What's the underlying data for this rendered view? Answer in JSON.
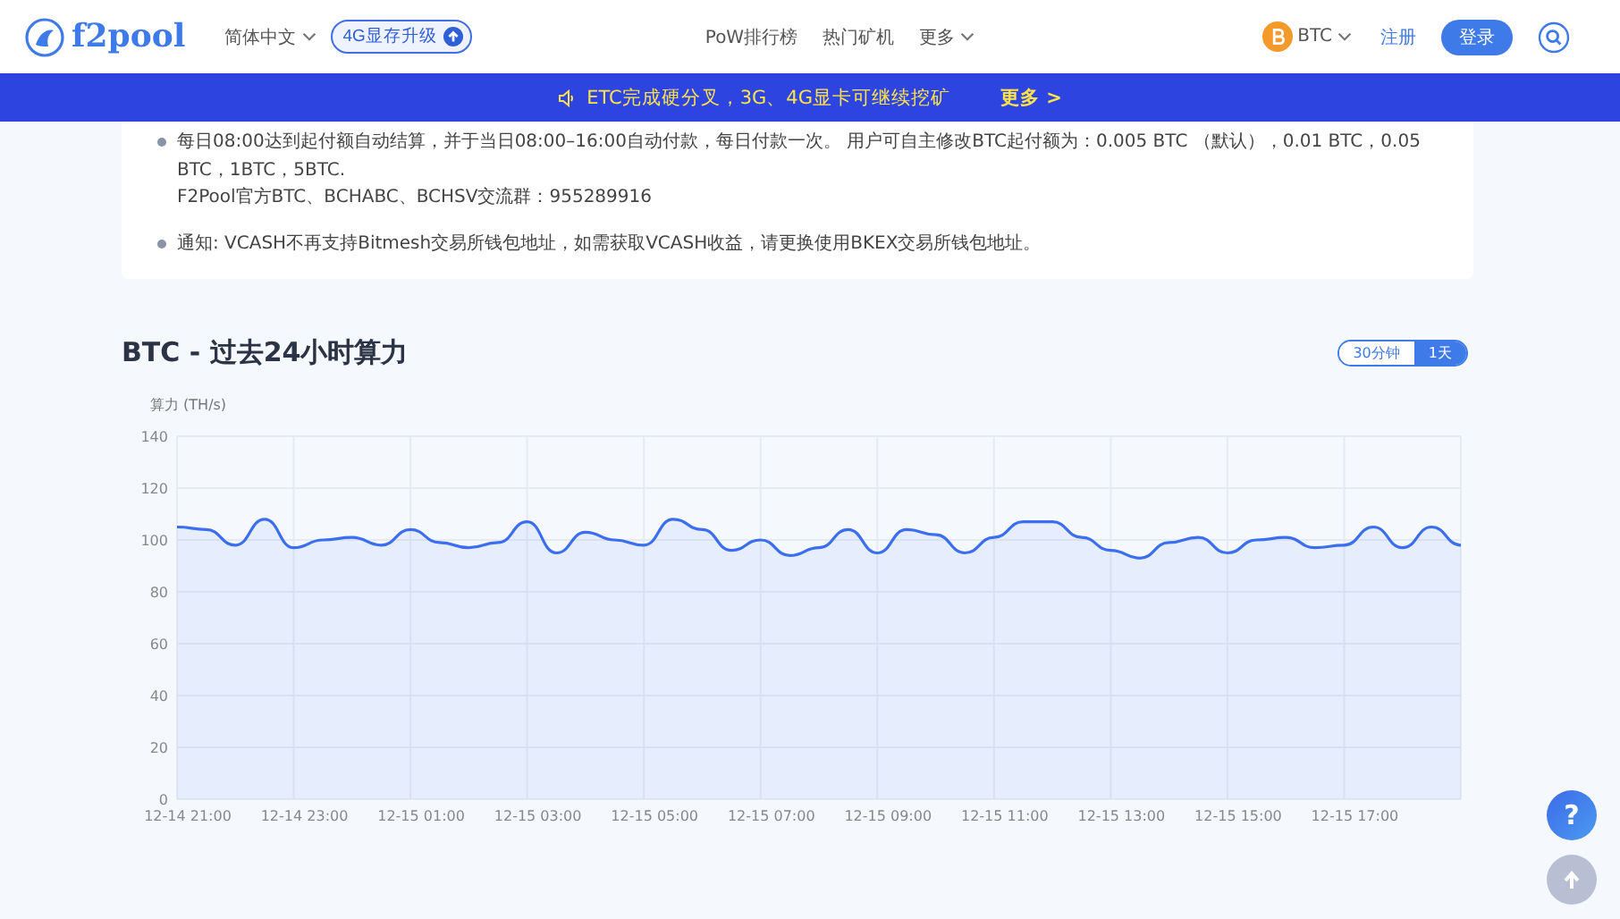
{
  "header": {
    "logo": "f2pool",
    "language": "简体中文",
    "upgrade_badge": "4G显存升级",
    "nav": [
      "PoW排行榜",
      "热门矿机",
      "更多"
    ],
    "coin": "BTC",
    "register": "注册",
    "login": "登录"
  },
  "banner": {
    "text": "ETC完成硬分叉，3G、4G显卡可继续挖矿",
    "link": "更多 >"
  },
  "notices": [
    {
      "text": "每日08:00达到起付额自动结算，并于当日08:00–16:00自动付款，每日付款一次。 用户可自主修改BTC起付额为：0.005 BTC （默认），0.01 BTC，0.05 BTC，1BTC，5BTC.",
      "note": "F2Pool官方BTC、BCHABC、BCHSV交流群：955289916"
    },
    {
      "text": "通知: VCASH不再支持Bitmesh交易所钱包地址，如需获取VCASH收益，请更换使用BKEX交易所钱包地址。"
    }
  ],
  "section_title": "BTC - 过去24小时算力",
  "ranges": [
    {
      "label": "30分钟",
      "selected": false
    },
    {
      "label": "1天",
      "selected": true
    }
  ],
  "chart_data": {
    "type": "area",
    "ylabel": "算力 (TH/s)",
    "categories": [
      "12-14 21:00",
      null,
      null,
      null,
      "12-14 23:00",
      null,
      null,
      null,
      "12-15 01:00",
      null,
      null,
      null,
      "12-15 03:00",
      null,
      null,
      null,
      "12-15 05:00",
      null,
      null,
      null,
      "12-15 07:00",
      null,
      null,
      null,
      "12-15 09:00",
      null,
      null,
      null,
      "12-15 11:00",
      null,
      null,
      null,
      "12-15 13:00",
      null,
      null,
      null,
      "12-15 15:00",
      null,
      null,
      null,
      "12-15 17:00",
      null,
      null,
      null,
      null
    ],
    "series": [
      {
        "color": "#3b6ff0",
        "values": [
          105,
          104,
          98,
          108,
          97,
          100,
          101,
          98,
          104,
          99,
          97,
          99,
          107,
          95,
          103,
          100,
          98,
          108,
          104,
          96,
          100,
          94,
          97,
          104,
          95,
          104,
          102,
          95,
          101,
          107,
          107,
          101,
          96,
          93,
          99,
          101,
          95,
          100,
          101,
          97,
          98,
          105,
          97,
          105,
          98
        ]
      }
    ],
    "grid": true,
    "ylim": [
      0,
      140
    ],
    "yticks": [
      0,
      20,
      40,
      60,
      80,
      100,
      120,
      140
    ]
  },
  "help_button": "?"
}
